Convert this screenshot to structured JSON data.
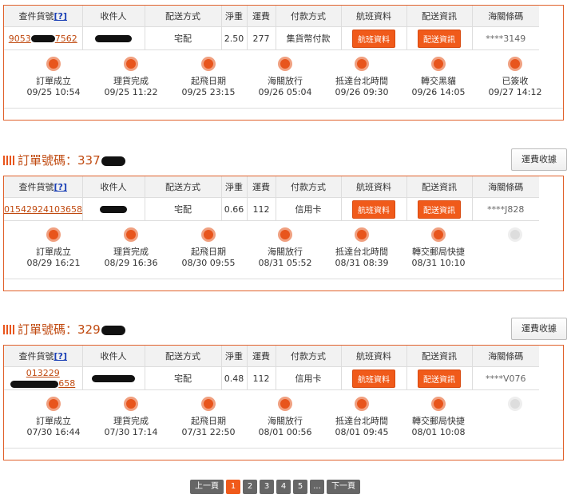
{
  "headers": [
    "查件貨號",
    "[?]",
    "收件人",
    "配送方式",
    "淨重",
    "運費",
    "付款方式",
    "航班資料",
    "配送資訊",
    "海關條碼"
  ],
  "buttons": {
    "flight": "航班資料",
    "delivery": "配送資訊",
    "track": "運費收據"
  },
  "order_prefix": "訂單號碼：",
  "orders": [
    {
      "order_no": "",
      "tracking": "9053",
      "tracking_suffix": "7562",
      "method": "宅配",
      "weight": "2.50",
      "fee": "277",
      "payment": "集貨幣付款",
      "customs": "****3149",
      "steps": [
        {
          "label": "訂單成立",
          "time": "09/25 10:54",
          "done": true
        },
        {
          "label": "理貨完成",
          "time": "09/25 11:22",
          "done": true
        },
        {
          "label": "起飛日期",
          "time": "09/25 23:15",
          "done": true
        },
        {
          "label": "海關放行",
          "time": "09/26 05:04",
          "done": true
        },
        {
          "label": "抵達台北時間",
          "time": "09/26 09:30",
          "done": true
        },
        {
          "label": "轉交黑貓",
          "time": "09/26 14:05",
          "done": true
        },
        {
          "label": "已簽收",
          "time": "09/27 14:12",
          "done": true
        }
      ]
    },
    {
      "order_no": "337",
      "tracking": "01542924103658",
      "tracking_suffix": "",
      "method": "宅配",
      "weight": "0.66",
      "fee": "112",
      "payment": "信用卡",
      "customs": "****J828",
      "steps": [
        {
          "label": "訂單成立",
          "time": "08/29 16:21",
          "done": true
        },
        {
          "label": "理貨完成",
          "time": "08/29 16:36",
          "done": true
        },
        {
          "label": "起飛日期",
          "time": "08/30 09:55",
          "done": true
        },
        {
          "label": "海關放行",
          "time": "08/31 05:52",
          "done": true
        },
        {
          "label": "抵達台北時間",
          "time": "08/31 08:39",
          "done": true
        },
        {
          "label": "轉交郵局快捷",
          "time": "08/31 10:10",
          "done": true
        },
        {
          "label": "",
          "time": "",
          "done": false
        }
      ]
    },
    {
      "order_no": "329",
      "tracking": "013229",
      "tracking_suffix": "658",
      "method": "宅配",
      "weight": "0.48",
      "fee": "112",
      "payment": "信用卡",
      "customs": "****V076",
      "steps": [
        {
          "label": "訂單成立",
          "time": "07/30 16:44",
          "done": true
        },
        {
          "label": "理貨完成",
          "time": "07/30 17:14",
          "done": true
        },
        {
          "label": "起飛日期",
          "time": "07/31 22:50",
          "done": true
        },
        {
          "label": "海關放行",
          "time": "08/01 00:56",
          "done": true
        },
        {
          "label": "抵達台北時間",
          "time": "08/01 09:45",
          "done": true
        },
        {
          "label": "轉交郵局快捷",
          "time": "08/01 10:08",
          "done": true
        },
        {
          "label": "",
          "time": "",
          "done": false
        }
      ]
    }
  ],
  "pagination": {
    "prev": "上一頁",
    "pages": [
      "1",
      "2",
      "3",
      "4",
      "5"
    ],
    "ellipsis": "...",
    "next": "下一頁",
    "current": "1"
  },
  "colors": {
    "accent": "#e8551c",
    "border": "#e0602a",
    "header_bg": "#f2f2f2"
  }
}
